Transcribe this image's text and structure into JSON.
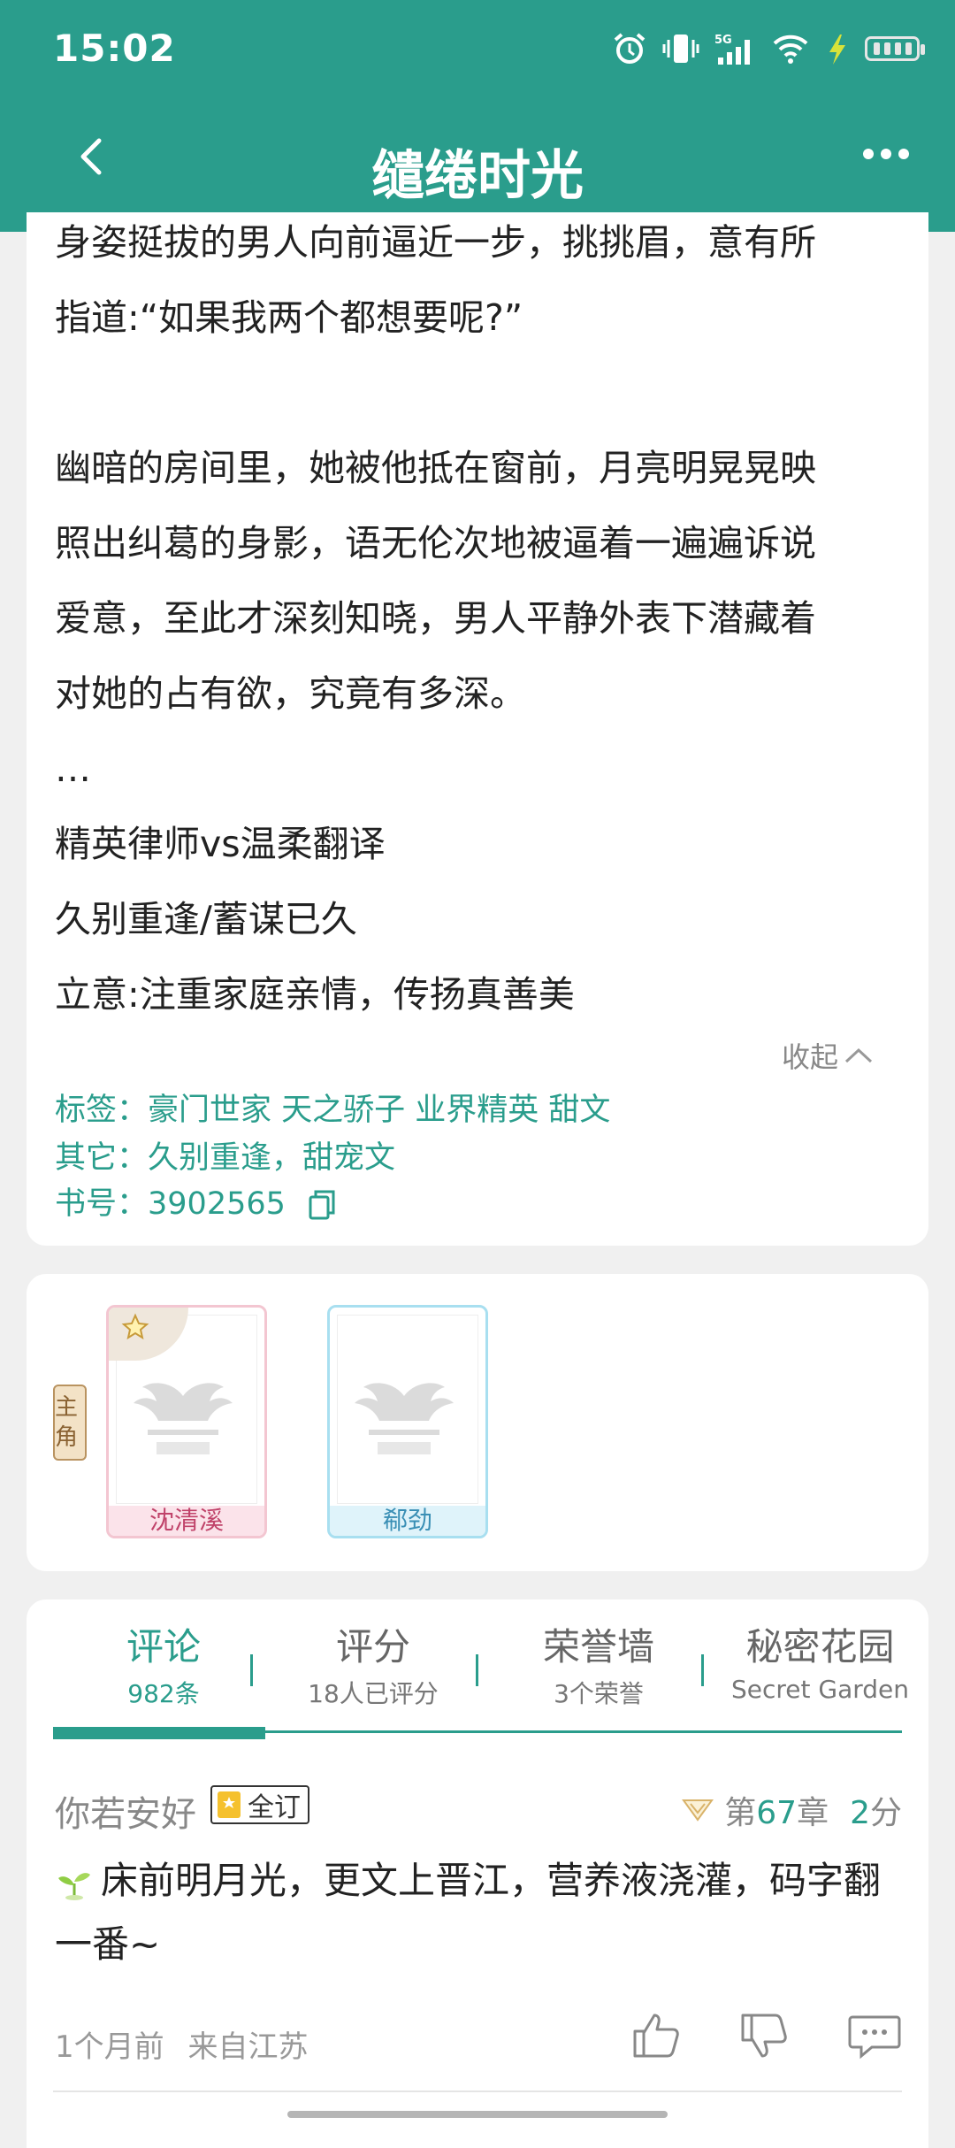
{
  "status_bar": {
    "time": "15:02",
    "icons": [
      "alarm-icon",
      "vibrate-icon",
      "signal-5g-icon",
      "wifi-icon",
      "charging-icon",
      "battery-icon"
    ]
  },
  "header": {
    "title": "缱绻时光",
    "back_icon": "chevron-left-icon",
    "more_icon": "more-dots-icon"
  },
  "synopsis": {
    "lines": [
      "身姿挺拔的男人向前逼近一步，挑挑眉，意有所",
      "指道:“如果我两个都想要呢?”",
      "",
      "幽暗的房间里，她被他抵在窗前，月亮明晃晃映",
      "照出纠葛的身影，语无伦次地被逼着一遍遍诉说",
      "爱意，至此才深刻知晓，男人平静外表下潜藏着",
      "对她的占有欲，究竟有多深。",
      "…",
      "精英律师vs温柔翻译",
      "久别重逢/蓄谋已久",
      "立意:注重家庭亲情，传扬真善美"
    ],
    "collapse_label": "收起"
  },
  "meta": {
    "tags_label": "标签：",
    "tags": "豪门世家 天之骄子 业界精英 甜文",
    "other_label": "其它：",
    "other": "久别重逢，甜宠文",
    "book_no_label": "书号：",
    "book_no": "3902565"
  },
  "characters": {
    "role_tag": "主角",
    "items": [
      {
        "name": "沈清溪"
      },
      {
        "name": "郗劲"
      }
    ]
  },
  "tabs": [
    {
      "label": "评论",
      "sub": "982条"
    },
    {
      "label": "评分",
      "sub": "18人已评分"
    },
    {
      "label": "荣誉墙",
      "sub": "3个荣誉"
    },
    {
      "label": "秘密花园",
      "sub": "Secret Garden"
    }
  ],
  "comment": {
    "user": "你若安好",
    "badge": "全订",
    "chapter_prefix": "第",
    "chapter_num": "67",
    "chapter_suffix": "章",
    "score_num": "2",
    "score_unit": "分",
    "text": "床前明月光，更文上晋江，营养液浇灌，码字翻一番~",
    "time": "1个月前",
    "location": "来自江苏"
  },
  "colors": {
    "accent": "#2a9d8c",
    "female_card": "#f3c6d1",
    "male_card": "#a8dff0"
  }
}
